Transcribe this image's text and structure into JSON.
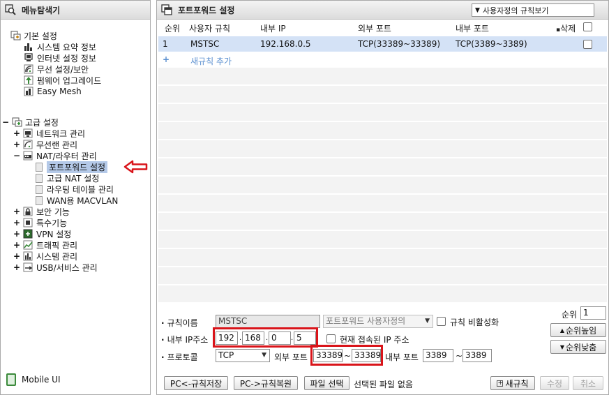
{
  "left": {
    "title": "메뉴탐색기",
    "tree": [
      {
        "id": "basic",
        "label": "기본 설정",
        "level": 0,
        "toggle": ""
      },
      {
        "id": "sys-summary",
        "label": "시스템 요약 정보",
        "level": 1
      },
      {
        "id": "internet",
        "label": "인터넷 설정 정보",
        "level": 1
      },
      {
        "id": "wireless",
        "label": "무선 설정/보안",
        "level": 1
      },
      {
        "id": "firmware",
        "label": "펌웨어 업그레이드",
        "level": 1
      },
      {
        "id": "easymesh",
        "label": "Easy Mesh",
        "level": 1
      },
      {
        "id": "advanced",
        "label": "고급 설정",
        "level": 0,
        "toggle": "−"
      },
      {
        "id": "network",
        "label": "네트워크 관리",
        "level": 1,
        "toggle": "+"
      },
      {
        "id": "wlan",
        "label": "무선랜 관리",
        "level": 1,
        "toggle": "+"
      },
      {
        "id": "nat",
        "label": "NAT/라우터 관리",
        "level": 1,
        "toggle": "−"
      },
      {
        "id": "portfwd",
        "label": "포트포워드 설정",
        "level": 2,
        "selected": true
      },
      {
        "id": "adv-nat",
        "label": "고급 NAT 설정",
        "level": 2
      },
      {
        "id": "routing",
        "label": "라우팅 테이블 관리",
        "level": 2
      },
      {
        "id": "macvlan",
        "label": "WAN용 MACVLAN",
        "level": 2
      },
      {
        "id": "security",
        "label": "보안 기능",
        "level": 1,
        "toggle": "+"
      },
      {
        "id": "special",
        "label": "특수기능",
        "level": 1,
        "toggle": "+"
      },
      {
        "id": "vpn",
        "label": "VPN 설정",
        "level": 1,
        "toggle": "+"
      },
      {
        "id": "traffic",
        "label": "트래픽 관리",
        "level": 1,
        "toggle": "+"
      },
      {
        "id": "system",
        "label": "시스템 관리",
        "level": 1,
        "toggle": "+"
      },
      {
        "id": "usb",
        "label": "USB/서비스 관리",
        "level": 1,
        "toggle": "+"
      }
    ],
    "mobile_ui": "Mobile UI"
  },
  "right": {
    "title": "포트포워드 설정",
    "view_select": "사용자정의 규칙보기",
    "headers": {
      "order": "순위",
      "rule": "사용자 규칙",
      "ip": "내부 IP",
      "ext_port": "외부 포트",
      "int_port": "내부 포트",
      "delete": "삭제"
    },
    "rows": [
      {
        "order": "1",
        "rule": "MSTSC",
        "ip": "192.168.0.5",
        "ext_port": "TCP(33389~33389)",
        "int_port": "TCP(3389~3389)"
      }
    ],
    "add_rule": "새규칙 추가",
    "form": {
      "rule_name_label": "규칙이름",
      "rule_name_value": "MSTSC",
      "rule_type_select": "포트포워드 사용자정의",
      "disable_rule_label": "규칙 비활성화",
      "ip_label": "내부 IP주소",
      "ip1": "192",
      "ip2": "168",
      "ip3": "0",
      "ip4": "5",
      "current_ip_label": "현재 접속된 IP 주소",
      "protocol_label": "프로토콜",
      "protocol_value": "TCP",
      "ext_port_label": "외부 포트",
      "ext_port_from": "33389",
      "ext_port_to": "33389",
      "tilde": "~",
      "int_port_label": "내부 포트",
      "int_port_from": "3389",
      "int_port_to": "3389",
      "rank_label": "순위",
      "rank_value": "1",
      "rank_up": "순위높임",
      "rank_down": "순위낮춤"
    },
    "buttons": {
      "save_pc": "PC<-규칙저장",
      "restore_pc": "PC->규칙복원",
      "file_select": "파일 선택",
      "file_status": "선택된 파일 없음",
      "new_rule": "새규칙",
      "modify": "수정",
      "cancel": "취소"
    }
  },
  "colors": {
    "selected_row": "#d4e2f6",
    "highlight_box": "#d9141a",
    "tree_selected": "#b4c9e8"
  }
}
